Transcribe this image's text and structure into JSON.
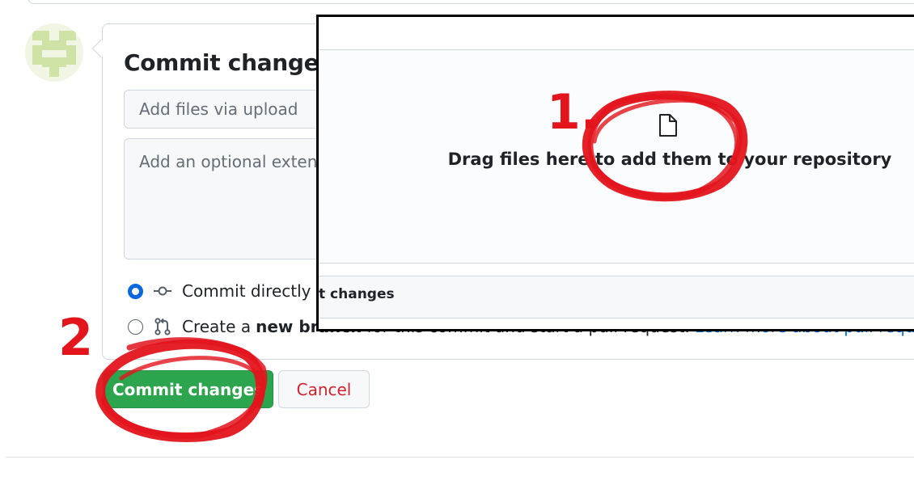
{
  "commit_form": {
    "title": "Commit changes",
    "summary_placeholder": "Add files via upload",
    "description_placeholder": "Add an optional extended description...",
    "options": [
      {
        "label": "Commit directly to",
        "icon": "git-commit-icon",
        "selected": true
      },
      {
        "label_prefix": "Create a",
        "label_bold": "new branch",
        "label_suffix": "for this commit and start a pull request.",
        "link_text": "Learn more about pull requests.",
        "icon": "git-pull-request-icon",
        "selected": false
      }
    ],
    "commit_button": "Commit changes",
    "cancel_button": "Cancel"
  },
  "upload_panel": {
    "drop_text": "Drag files here to add them to your repository",
    "icon": "file-icon",
    "strip_text": "t changes"
  },
  "annotations": {
    "step1": "1.",
    "step2": "2"
  },
  "colors": {
    "primary_button": "#2da44e",
    "cancel_text": "#cf222e",
    "link": "#0969da",
    "annotation": "#e3141c"
  }
}
